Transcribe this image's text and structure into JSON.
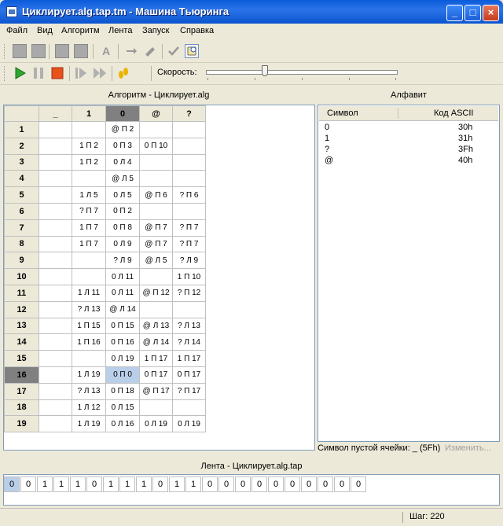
{
  "window": {
    "title": "Циклирует.alg.tap.tm - Машина Тьюринга"
  },
  "menu": [
    "Файл",
    "Вид",
    "Алгоритм",
    "Лента",
    "Запуск",
    "Справка"
  ],
  "toolbar": {
    "speed_label": "Скорость:",
    "speed_value": 0.32
  },
  "algorithm": {
    "header": "Алгоритм - Циклирует.alg",
    "columns": [
      "_",
      "1",
      "0",
      "@",
      "?"
    ],
    "active_column": 2,
    "active_row": 16,
    "rows": [
      {
        "n": "1",
        "cells": [
          "",
          "",
          "@ П 2",
          "",
          ""
        ]
      },
      {
        "n": "2",
        "cells": [
          "",
          "1 П 2",
          "0 П 3",
          "0 П 10",
          ""
        ]
      },
      {
        "n": "3",
        "cells": [
          "",
          "1 П 2",
          "0 Л 4",
          "",
          ""
        ]
      },
      {
        "n": "4",
        "cells": [
          "",
          "",
          "@ Л 5",
          "",
          ""
        ]
      },
      {
        "n": "5",
        "cells": [
          "",
          "1 Л 5",
          "0 Л 5",
          "@ П 6",
          "? П 6"
        ]
      },
      {
        "n": "6",
        "cells": [
          "",
          "? П 7",
          "0 П 2",
          "",
          ""
        ]
      },
      {
        "n": "7",
        "cells": [
          "",
          "1 П 7",
          "0 П 8",
          "@ П 7",
          "? П 7"
        ]
      },
      {
        "n": "8",
        "cells": [
          "",
          "1 П 7",
          "0 Л 9",
          "@ П 7",
          "? П 7"
        ]
      },
      {
        "n": "9",
        "cells": [
          "",
          "",
          "? Л 9",
          "@ Л 5",
          "? Л 9"
        ]
      },
      {
        "n": "10",
        "cells": [
          "",
          "",
          "0 Л 11",
          "",
          "1 П 10"
        ]
      },
      {
        "n": "11",
        "cells": [
          "",
          "1 Л 11",
          "0 Л 11",
          "@ П 12",
          "? П 12"
        ]
      },
      {
        "n": "12",
        "cells": [
          "",
          "? Л 13",
          "@ Л 14",
          "",
          ""
        ]
      },
      {
        "n": "13",
        "cells": [
          "",
          "1 П 15",
          "0 П 15",
          "@ Л 13",
          "? Л 13"
        ]
      },
      {
        "n": "14",
        "cells": [
          "",
          "1 П 16",
          "0 П 16",
          "@ Л 14",
          "? Л 14"
        ]
      },
      {
        "n": "15",
        "cells": [
          "",
          "",
          "0 Л 19",
          "1 П 17",
          "1 П 17"
        ]
      },
      {
        "n": "16",
        "cells": [
          "",
          "1 Л 19",
          "0 П 0",
          "0 П 17",
          "0 П 17"
        ]
      },
      {
        "n": "17",
        "cells": [
          "",
          "? Л 13",
          "0 П 18",
          "@ П 17",
          "? П 17"
        ]
      },
      {
        "n": "18",
        "cells": [
          "",
          "1 Л 12",
          "0 Л 15",
          "",
          ""
        ]
      },
      {
        "n": "19",
        "cells": [
          "",
          "1 Л 19",
          "0 Л 16",
          "0 Л 19",
          "0 Л 19"
        ]
      }
    ],
    "selected_cell": {
      "row": 16,
      "col": 2
    }
  },
  "alphabet": {
    "header": "Алфавит",
    "col_symbol": "Символ",
    "col_ascii": "Код ASCII",
    "items": [
      {
        "symbol": "0",
        "code": "30h"
      },
      {
        "symbol": "1",
        "code": "31h"
      },
      {
        "symbol": "?",
        "code": "3Fh"
      },
      {
        "symbol": "@",
        "code": "40h"
      }
    ],
    "blank_label": "Символ пустой ячейки: _ (5Fh)",
    "change_button": "Изменить..."
  },
  "tape": {
    "header": "Лента - Циклирует.alg.tap",
    "cells": [
      "0",
      "0",
      "1",
      "1",
      "1",
      "0",
      "1",
      "1",
      "1",
      "0",
      "1",
      "1",
      "0",
      "0",
      "0",
      "0",
      "0",
      "0",
      "0",
      "0",
      "0",
      "0"
    ],
    "selected_index": 0
  },
  "status": {
    "step": "Шаг: 220"
  }
}
